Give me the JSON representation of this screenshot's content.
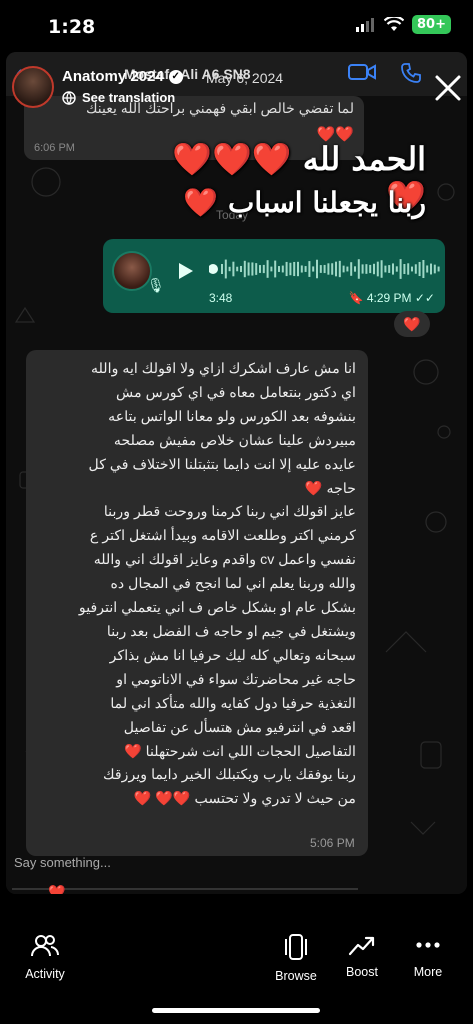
{
  "status": {
    "time": "1:28",
    "battery": "80+"
  },
  "whatsapp": {
    "header_name": "Mostafa Ali A6 SN8",
    "msg1_text": "لما تفضي خالص ابقي فهمني براحتك الله يعينك",
    "msg1_hearts": "❤️❤️",
    "msg1_time": "6:06 PM",
    "sticker_line1": "الحمد لله ❤️❤️❤️❤️",
    "sticker_line2": "ربنا يجعلنا اسباب ❤️",
    "today": "Today",
    "voice_duration": "3:48",
    "voice_time": "4:29 PM",
    "reaction": "❤️",
    "msg2_lines": [
      "انا مش عارف اشكرك ازاي ولا اقولك  ايه والله",
      "اي دكتور بنتعامل معاه في اي كورس مش",
      "بنشوفه بعد الكورس ولو معانا الواتس بتاعه",
      "مبيردش علينا عشان خلاص مفيش مصلحه",
      "عايده عليه إلا انت دايما بتثبتلنا الاختلاف في كل",
      "حاجه ❤️",
      "عايز اقولك اني ربنا كرمنا وروحت قطر وربنا",
      "كرمني اكتر وطلعت الاقامه وبيدأ اشتغل اكتر ع",
      "نفسي واعمل cv واقدم وعايز اقولك اني والله",
      "والله وربنا يعلم اني لما انجح في المجال ده",
      "بشكل عام او بشكل خاص ف اني يتعملي انترفيو",
      "ويشتغل في جيم او حاجه ف الفضل بعد ربنا",
      "سبحانه وتعالي كله ليك حرفيا انا مش بذاكر",
      "حاجه غير محاضرتك سواء في الاناتومي او",
      "التغذية حرفيا دول كفايه والله متأكد اني لما",
      "اقعد في انترفيو مش هتسأل عن تفاصيل",
      "التفاصيل الحجات اللي انت شرحتهلنا ❤️",
      "ربنا يوفقك يارب ويكتبلك الخير دايما  ويرزقك",
      "من حيث لا تدري ولا تحتسب ❤️❤️ ❤️"
    ],
    "msg2_time": "5:06 PM"
  },
  "story": {
    "account": "Anatomy 2024",
    "date": "May 6, 2024",
    "translation": "See translation",
    "reply_placeholder": "Say something...",
    "mini_heart": "❤️"
  },
  "tabs": [
    {
      "label": "Activity",
      "icon": "people-icon"
    },
    {
      "label": "Browse",
      "icon": "phone-frame-icon"
    },
    {
      "label": "Boost",
      "icon": "trend-up-icon"
    },
    {
      "label": "More",
      "icon": "ellipsis-icon"
    }
  ],
  "colors": {
    "voice_bubble": "#0d5c4b",
    "incoming_bubble": "#2b2b2b",
    "battery": "#34c759",
    "link_blue": "#3b82f6"
  }
}
